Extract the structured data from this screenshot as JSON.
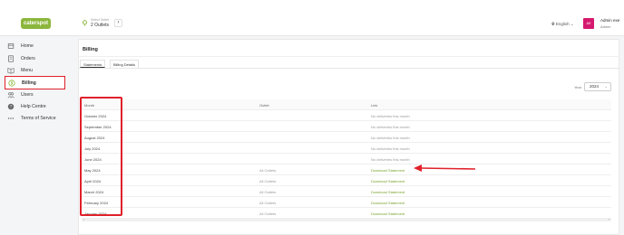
{
  "app": {
    "logo_text": "caterspot"
  },
  "topbar": {
    "outlet_label": "Select Outlet",
    "outlet_value": "2 Outlets",
    "language": "English",
    "avatar_initials": "AE",
    "admin_name": "Admin exe",
    "admin_role": "Admin"
  },
  "sidebar": {
    "items": [
      {
        "label": "Home",
        "icon": "home-icon"
      },
      {
        "label": "Orders",
        "icon": "orders-icon"
      },
      {
        "label": "Menu",
        "icon": "menu-icon"
      },
      {
        "label": "Billing",
        "icon": "billing-icon",
        "active": true
      },
      {
        "label": "Users",
        "icon": "users-icon"
      },
      {
        "label": "Help Centre",
        "icon": "help-icon"
      },
      {
        "label": "Terms of Service",
        "icon": "more-icon"
      }
    ]
  },
  "page": {
    "title": "Billing",
    "tabs": [
      "Statements",
      "Billing Details"
    ],
    "year_label": "Year",
    "year_value": "2024"
  },
  "table": {
    "headers": [
      "Month",
      "Outlet",
      "Link"
    ],
    "rows": [
      {
        "month": "October 2024",
        "outlet": "",
        "link": "No deliveries this month",
        "link_type": "none"
      },
      {
        "month": "September 2024",
        "outlet": "",
        "link": "No deliveries this month",
        "link_type": "none"
      },
      {
        "month": "August 2024",
        "outlet": "",
        "link": "No deliveries this month",
        "link_type": "none"
      },
      {
        "month": "July 2024",
        "outlet": "",
        "link": "No deliveries this month",
        "link_type": "none"
      },
      {
        "month": "June 2024",
        "outlet": "",
        "link": "No deliveries this month",
        "link_type": "none"
      },
      {
        "month": "May 2024",
        "outlet": "All Outlets",
        "link": "Download Statement",
        "link_type": "download"
      },
      {
        "month": "April 2024",
        "outlet": "All Outlets",
        "link": "Download Statement",
        "link_type": "download"
      },
      {
        "month": "March 2024",
        "outlet": "All Outlets",
        "link": "Download Statement",
        "link_type": "download"
      },
      {
        "month": "February 2024",
        "outlet": "All Outlets",
        "link": "Download Statement",
        "link_type": "download"
      },
      {
        "month": "January 2024",
        "outlet": "All Outlets",
        "link": "Download Statement",
        "link_type": "download"
      }
    ]
  },
  "colors": {
    "brand": "#8cb63c",
    "highlight": "#e0202a",
    "avatar": "#d6186f",
    "link": "#7aa22e"
  }
}
